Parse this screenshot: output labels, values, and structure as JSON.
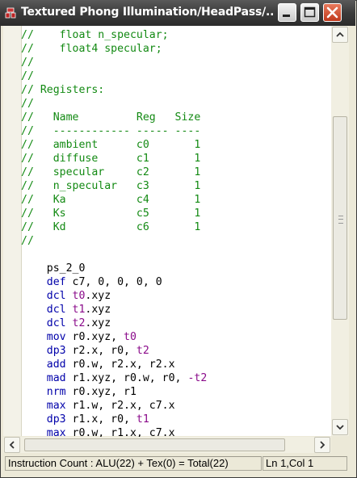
{
  "window": {
    "title": "Textured Phong Illumination/HeadPass/...",
    "buttons": {
      "minimize": "minimize-icon",
      "maximize": "maximize-icon",
      "close": "close-icon"
    }
  },
  "editor": {
    "lines": [
      [
        {
          "t": "//    float n_specular;",
          "s": "c"
        }
      ],
      [
        {
          "t": "//    float4 specular;",
          "s": "c"
        }
      ],
      [
        {
          "t": "//",
          "s": "c"
        }
      ],
      [
        {
          "t": "//",
          "s": "c"
        }
      ],
      [
        {
          "t": "// Registers:",
          "s": "c"
        }
      ],
      [
        {
          "t": "//",
          "s": "c"
        }
      ],
      [
        {
          "t": "//   Name         Reg   Size",
          "s": "c"
        }
      ],
      [
        {
          "t": "//   ------------ ----- ----",
          "s": "c"
        }
      ],
      [
        {
          "t": "//   ambient      c0       1",
          "s": "c"
        }
      ],
      [
        {
          "t": "//   diffuse      c1       1",
          "s": "c"
        }
      ],
      [
        {
          "t": "//   specular     c2       1",
          "s": "c"
        }
      ],
      [
        {
          "t": "//   n_specular   c3       1",
          "s": "c"
        }
      ],
      [
        {
          "t": "//   Ka           c4       1",
          "s": "c"
        }
      ],
      [
        {
          "t": "//   Ks           c5       1",
          "s": "c"
        }
      ],
      [
        {
          "t": "//   Kd           c6       1",
          "s": "c"
        }
      ],
      [
        {
          "t": "//",
          "s": "c"
        }
      ],
      [
        {
          "t": "",
          "s": ""
        }
      ],
      [
        {
          "t": "    ps_2_0",
          "s": ""
        }
      ],
      [
        {
          "t": "    def",
          "s": "k"
        },
        {
          "t": " c7, 0, 0, 0, 0",
          "s": ""
        }
      ],
      [
        {
          "t": "    dcl",
          "s": "k"
        },
        {
          "t": " ",
          "s": ""
        },
        {
          "t": "t0",
          "s": "r"
        },
        {
          "t": ".xyz",
          "s": ""
        }
      ],
      [
        {
          "t": "    dcl",
          "s": "k"
        },
        {
          "t": " ",
          "s": ""
        },
        {
          "t": "t1",
          "s": "r"
        },
        {
          "t": ".xyz",
          "s": ""
        }
      ],
      [
        {
          "t": "    dcl",
          "s": "k"
        },
        {
          "t": " ",
          "s": ""
        },
        {
          "t": "t2",
          "s": "r"
        },
        {
          "t": ".xyz",
          "s": ""
        }
      ],
      [
        {
          "t": "    mov",
          "s": "k"
        },
        {
          "t": " r0.xyz, ",
          "s": ""
        },
        {
          "t": "t0",
          "s": "r"
        }
      ],
      [
        {
          "t": "    dp3",
          "s": "k"
        },
        {
          "t": " r2.x, r0, ",
          "s": ""
        },
        {
          "t": "t2",
          "s": "r"
        }
      ],
      [
        {
          "t": "    add",
          "s": "k"
        },
        {
          "t": " r0.w, r2.x, r2.x",
          "s": ""
        }
      ],
      [
        {
          "t": "    mad",
          "s": "k"
        },
        {
          "t": " r1.xyz, r0.w, r0, ",
          "s": ""
        },
        {
          "t": "-t2",
          "s": "r"
        }
      ],
      [
        {
          "t": "    nrm",
          "s": "k"
        },
        {
          "t": " r0.xyz, r1",
          "s": ""
        }
      ],
      [
        {
          "t": "    max",
          "s": "k"
        },
        {
          "t": " r1.w, r2.x, c7.x",
          "s": ""
        }
      ],
      [
        {
          "t": "    dp3",
          "s": "k"
        },
        {
          "t": " r1.x, r0, ",
          "s": ""
        },
        {
          "t": "t1",
          "s": "r"
        }
      ],
      [
        {
          "t": "    max",
          "s": "k"
        },
        {
          "t": " r0.w, r1.x, c7.x",
          "s": ""
        }
      ]
    ]
  },
  "status": {
    "instruction_count": "Instruction Count :  ALU(22) + Tex(0) = Total(22)",
    "position": "Ln 1,Col 1"
  },
  "colors": {
    "comment": "#138a13",
    "keyword": "#0000aa",
    "register": "#8a0a8a"
  }
}
